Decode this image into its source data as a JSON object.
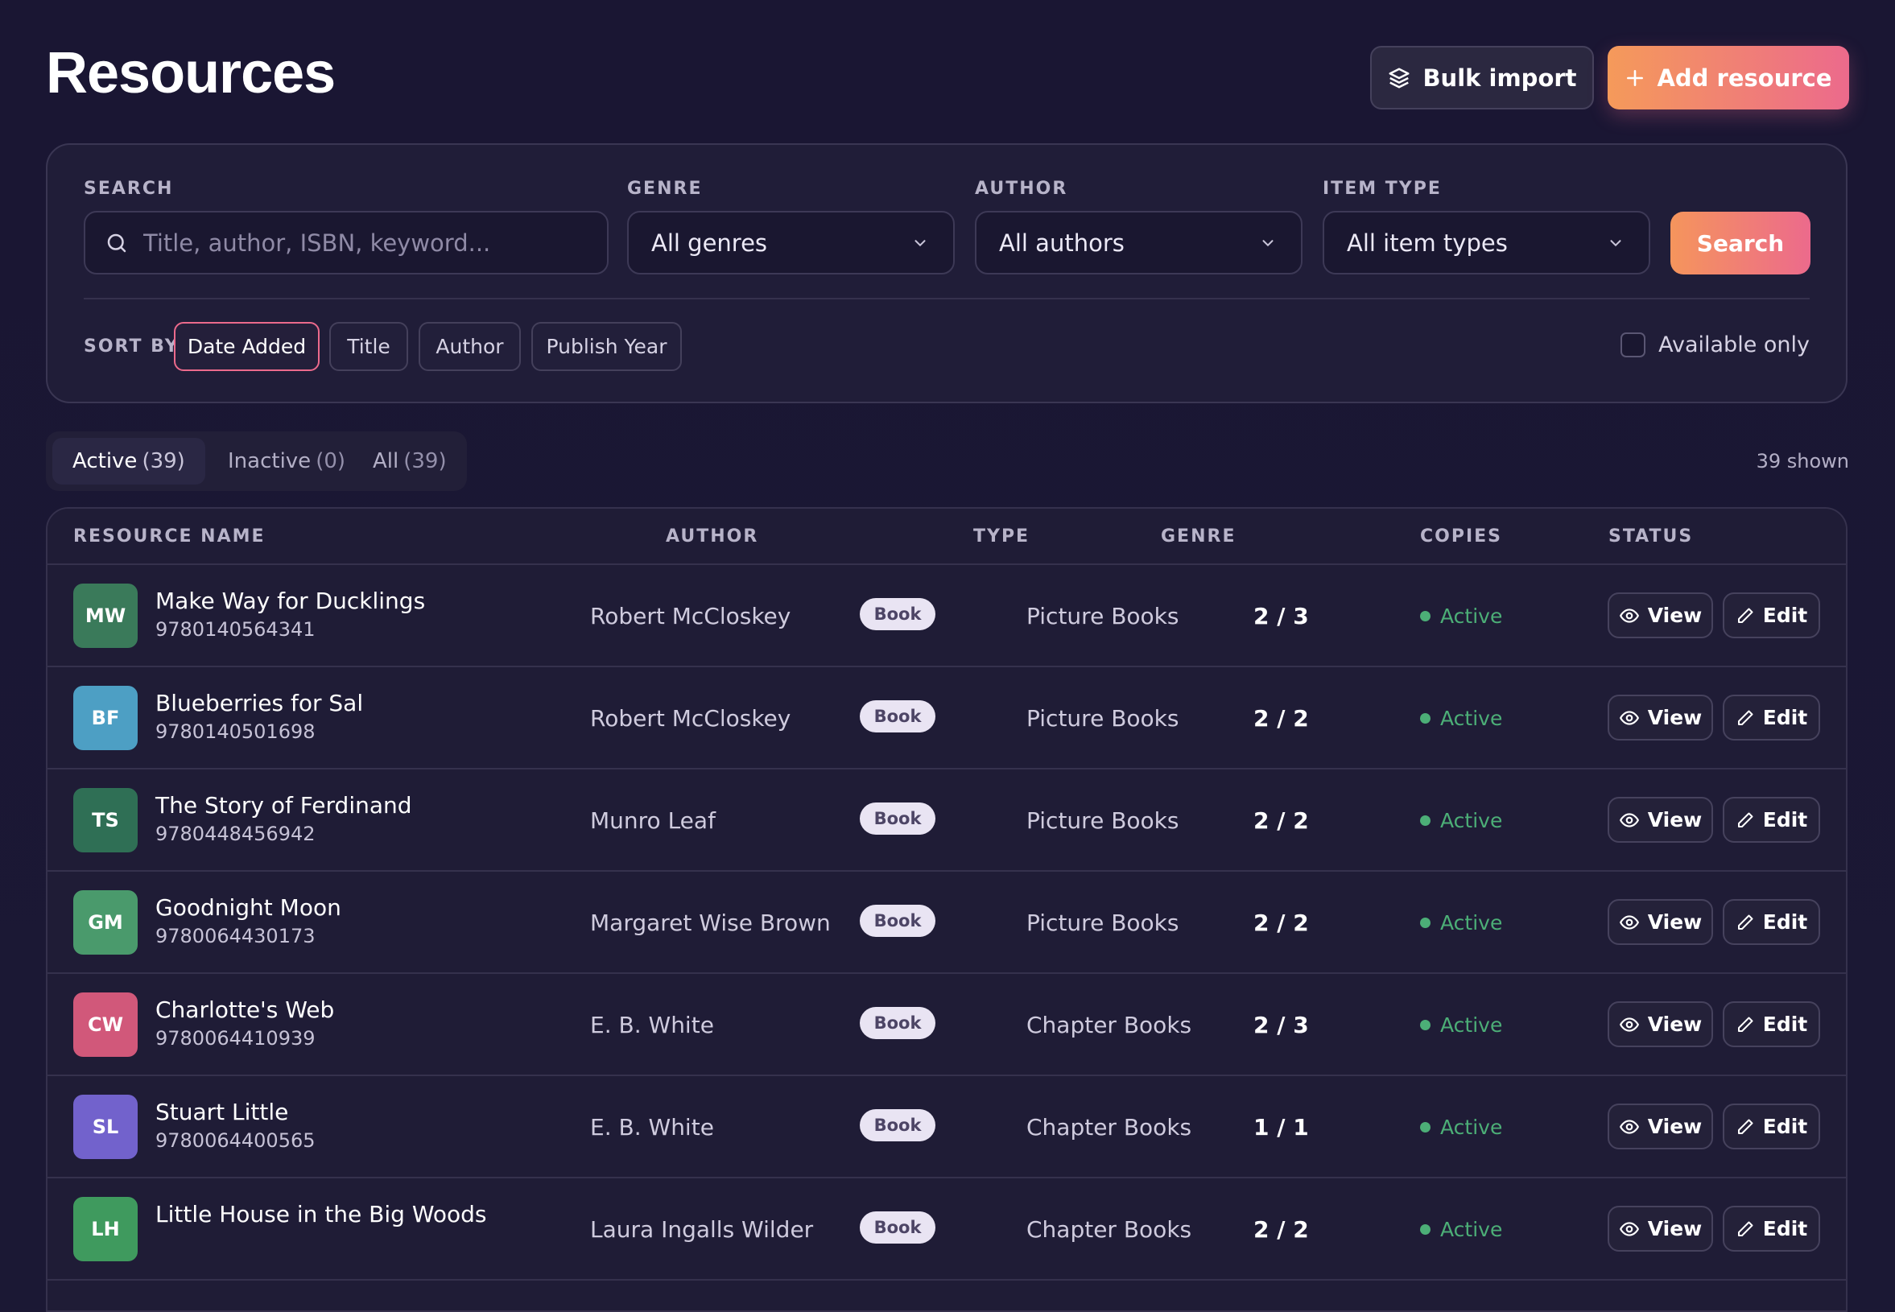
{
  "header": {
    "title": "Resources",
    "bulk_import_label": "Bulk import",
    "add_resource_label": "Add resource"
  },
  "filters": {
    "search_label": "SEARCH",
    "search_placeholder": "Title, author, ISBN, keyword...",
    "genre_label": "GENRE",
    "genre_value": "All genres",
    "author_label": "AUTHOR",
    "author_value": "All authors",
    "item_type_label": "ITEM TYPE",
    "item_type_value": "All item types",
    "search_button": "Search",
    "sort_label": "SORT BY",
    "sort_options": [
      "Date Added",
      "Title",
      "Author",
      "Publish Year"
    ],
    "sort_selected": "Date Added",
    "available_only_label": "Available only",
    "available_only_checked": false
  },
  "tabs": [
    {
      "label": "Active",
      "count": "(39)",
      "active": true
    },
    {
      "label": "Inactive",
      "count": "(0)",
      "active": false
    },
    {
      "label": "All",
      "count": "(39)",
      "active": false
    }
  ],
  "shown_count": "39 shown",
  "table": {
    "columns": [
      "RESOURCE NAME",
      "AUTHOR",
      "TYPE",
      "GENRE",
      "COPIES",
      "STATUS"
    ],
    "view_label": "View",
    "edit_label": "Edit",
    "rows": [
      {
        "initials": "MW",
        "avatar_color": "#3a7a5a",
        "title": "Make Way for Ducklings",
        "isbn": "9780140564341",
        "author": "Robert McCloskey",
        "type": "Book",
        "genre": "Picture Books",
        "copies": "2 / 3",
        "status": "Active"
      },
      {
        "initials": "BF",
        "avatar_color": "#4d9fc4",
        "title": "Blueberries for Sal",
        "isbn": "9780140501698",
        "author": "Robert McCloskey",
        "type": "Book",
        "genre": "Picture Books",
        "copies": "2 / 2",
        "status": "Active"
      },
      {
        "initials": "TS",
        "avatar_color": "#2f6f55",
        "title": "The Story of Ferdinand",
        "isbn": "9780448456942",
        "author": "Munro Leaf",
        "type": "Book",
        "genre": "Picture Books",
        "copies": "2 / 2",
        "status": "Active"
      },
      {
        "initials": "GM",
        "avatar_color": "#4a9a6c",
        "title": "Goodnight Moon",
        "isbn": "9780064430173",
        "author": "Margaret Wise Brown",
        "type": "Book",
        "genre": "Picture Books",
        "copies": "2 / 2",
        "status": "Active"
      },
      {
        "initials": "CW",
        "avatar_color": "#d1587a",
        "title": "Charlotte's Web",
        "isbn": "9780064410939",
        "author": "E. B. White",
        "type": "Book",
        "genre": "Chapter Books",
        "copies": "2 / 3",
        "status": "Active"
      },
      {
        "initials": "SL",
        "avatar_color": "#7262cc",
        "title": "Stuart Little",
        "isbn": "9780064400565",
        "author": "E. B. White",
        "type": "Book",
        "genre": "Chapter Books",
        "copies": "1 / 1",
        "status": "Active"
      },
      {
        "initials": "LH",
        "avatar_color": "#3f9a5e",
        "title": "Little House in the Big Woods",
        "isbn": "",
        "author": "Laura Ingalls Wilder",
        "type": "Book",
        "genre": "Chapter Books",
        "copies": "2 / 2",
        "status": "Active"
      }
    ]
  }
}
